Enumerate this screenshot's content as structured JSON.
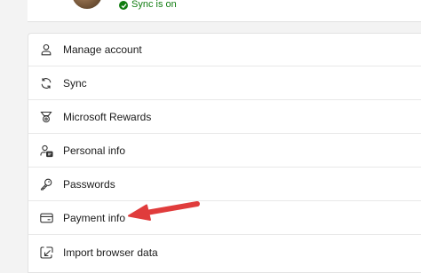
{
  "profile": {
    "sync_status": "Sync is on",
    "status_color": "#107c10"
  },
  "menu": {
    "items": [
      {
        "label": "Manage account",
        "icon": "person-icon"
      },
      {
        "label": "Sync",
        "icon": "sync-icon"
      },
      {
        "label": "Microsoft Rewards",
        "icon": "rewards-icon"
      },
      {
        "label": "Personal info",
        "icon": "personal-info-icon"
      },
      {
        "label": "Passwords",
        "icon": "key-icon"
      },
      {
        "label": "Payment info",
        "icon": "credit-card-icon"
      },
      {
        "label": "Import browser data",
        "icon": "import-icon"
      }
    ]
  },
  "annotation": {
    "arrow_color": "#e03c3c"
  }
}
